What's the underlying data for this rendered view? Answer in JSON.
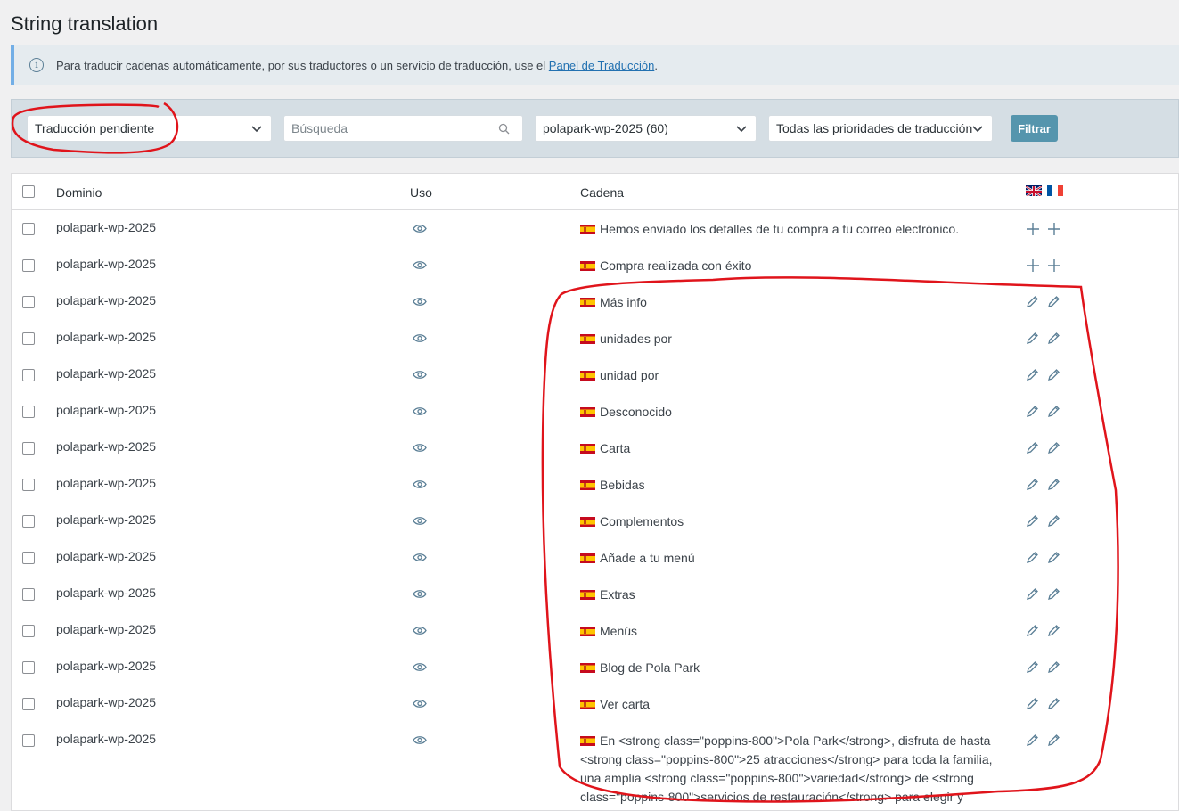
{
  "page": {
    "title": "String translation"
  },
  "notice": {
    "text": "Para traducir cadenas automáticamente, por sus traductores o un servicio de traducción, use el ",
    "link": "Panel de Traducción",
    "suffix": "."
  },
  "filters": {
    "status": "Traducción pendiente",
    "search_placeholder": "Búsqueda",
    "domain": "polapark-wp-2025 (60)",
    "priority": "Todas las prioridades de traducción",
    "button": "Filtrar"
  },
  "table": {
    "columns": {
      "domain": "Dominio",
      "usage": "Uso",
      "string": "Cadena"
    },
    "rows": [
      {
        "domain": "polapark-wp-2025",
        "string": "Hemos enviado los detalles de tu compra a tu correo electrónico.",
        "action": "add"
      },
      {
        "domain": "polapark-wp-2025",
        "string": "Compra realizada con éxito",
        "action": "add"
      },
      {
        "domain": "polapark-wp-2025",
        "string": "Más info",
        "action": "edit"
      },
      {
        "domain": "polapark-wp-2025",
        "string": "unidades por",
        "action": "edit"
      },
      {
        "domain": "polapark-wp-2025",
        "string": "unidad por",
        "action": "edit"
      },
      {
        "domain": "polapark-wp-2025",
        "string": "Desconocido",
        "action": "edit"
      },
      {
        "domain": "polapark-wp-2025",
        "string": "Carta",
        "action": "edit"
      },
      {
        "domain": "polapark-wp-2025",
        "string": "Bebidas",
        "action": "edit"
      },
      {
        "domain": "polapark-wp-2025",
        "string": "Complementos",
        "action": "edit"
      },
      {
        "domain": "polapark-wp-2025",
        "string": "Añade a tu menú",
        "action": "edit"
      },
      {
        "domain": "polapark-wp-2025",
        "string": "Extras",
        "action": "edit"
      },
      {
        "domain": "polapark-wp-2025",
        "string": "Menús",
        "action": "edit"
      },
      {
        "domain": "polapark-wp-2025",
        "string": "Blog de Pola Park",
        "action": "edit"
      },
      {
        "domain": "polapark-wp-2025",
        "string": "Ver carta",
        "action": "edit"
      },
      {
        "domain": "polapark-wp-2025",
        "string": "En <strong class=\"poppins-800\">Pola Park</strong>, disfruta de hasta <strong class=\"poppins-800\">25 atracciones</strong> para toda la familia, una amplia <strong class=\"poppins-800\">variedad</strong> de <strong class=\"poppins-800\">servicios de restauración</strong> para elegir y",
        "action": "edit"
      }
    ]
  },
  "colors": {
    "accent": "#5595ad",
    "annotation": "#e0141b"
  }
}
